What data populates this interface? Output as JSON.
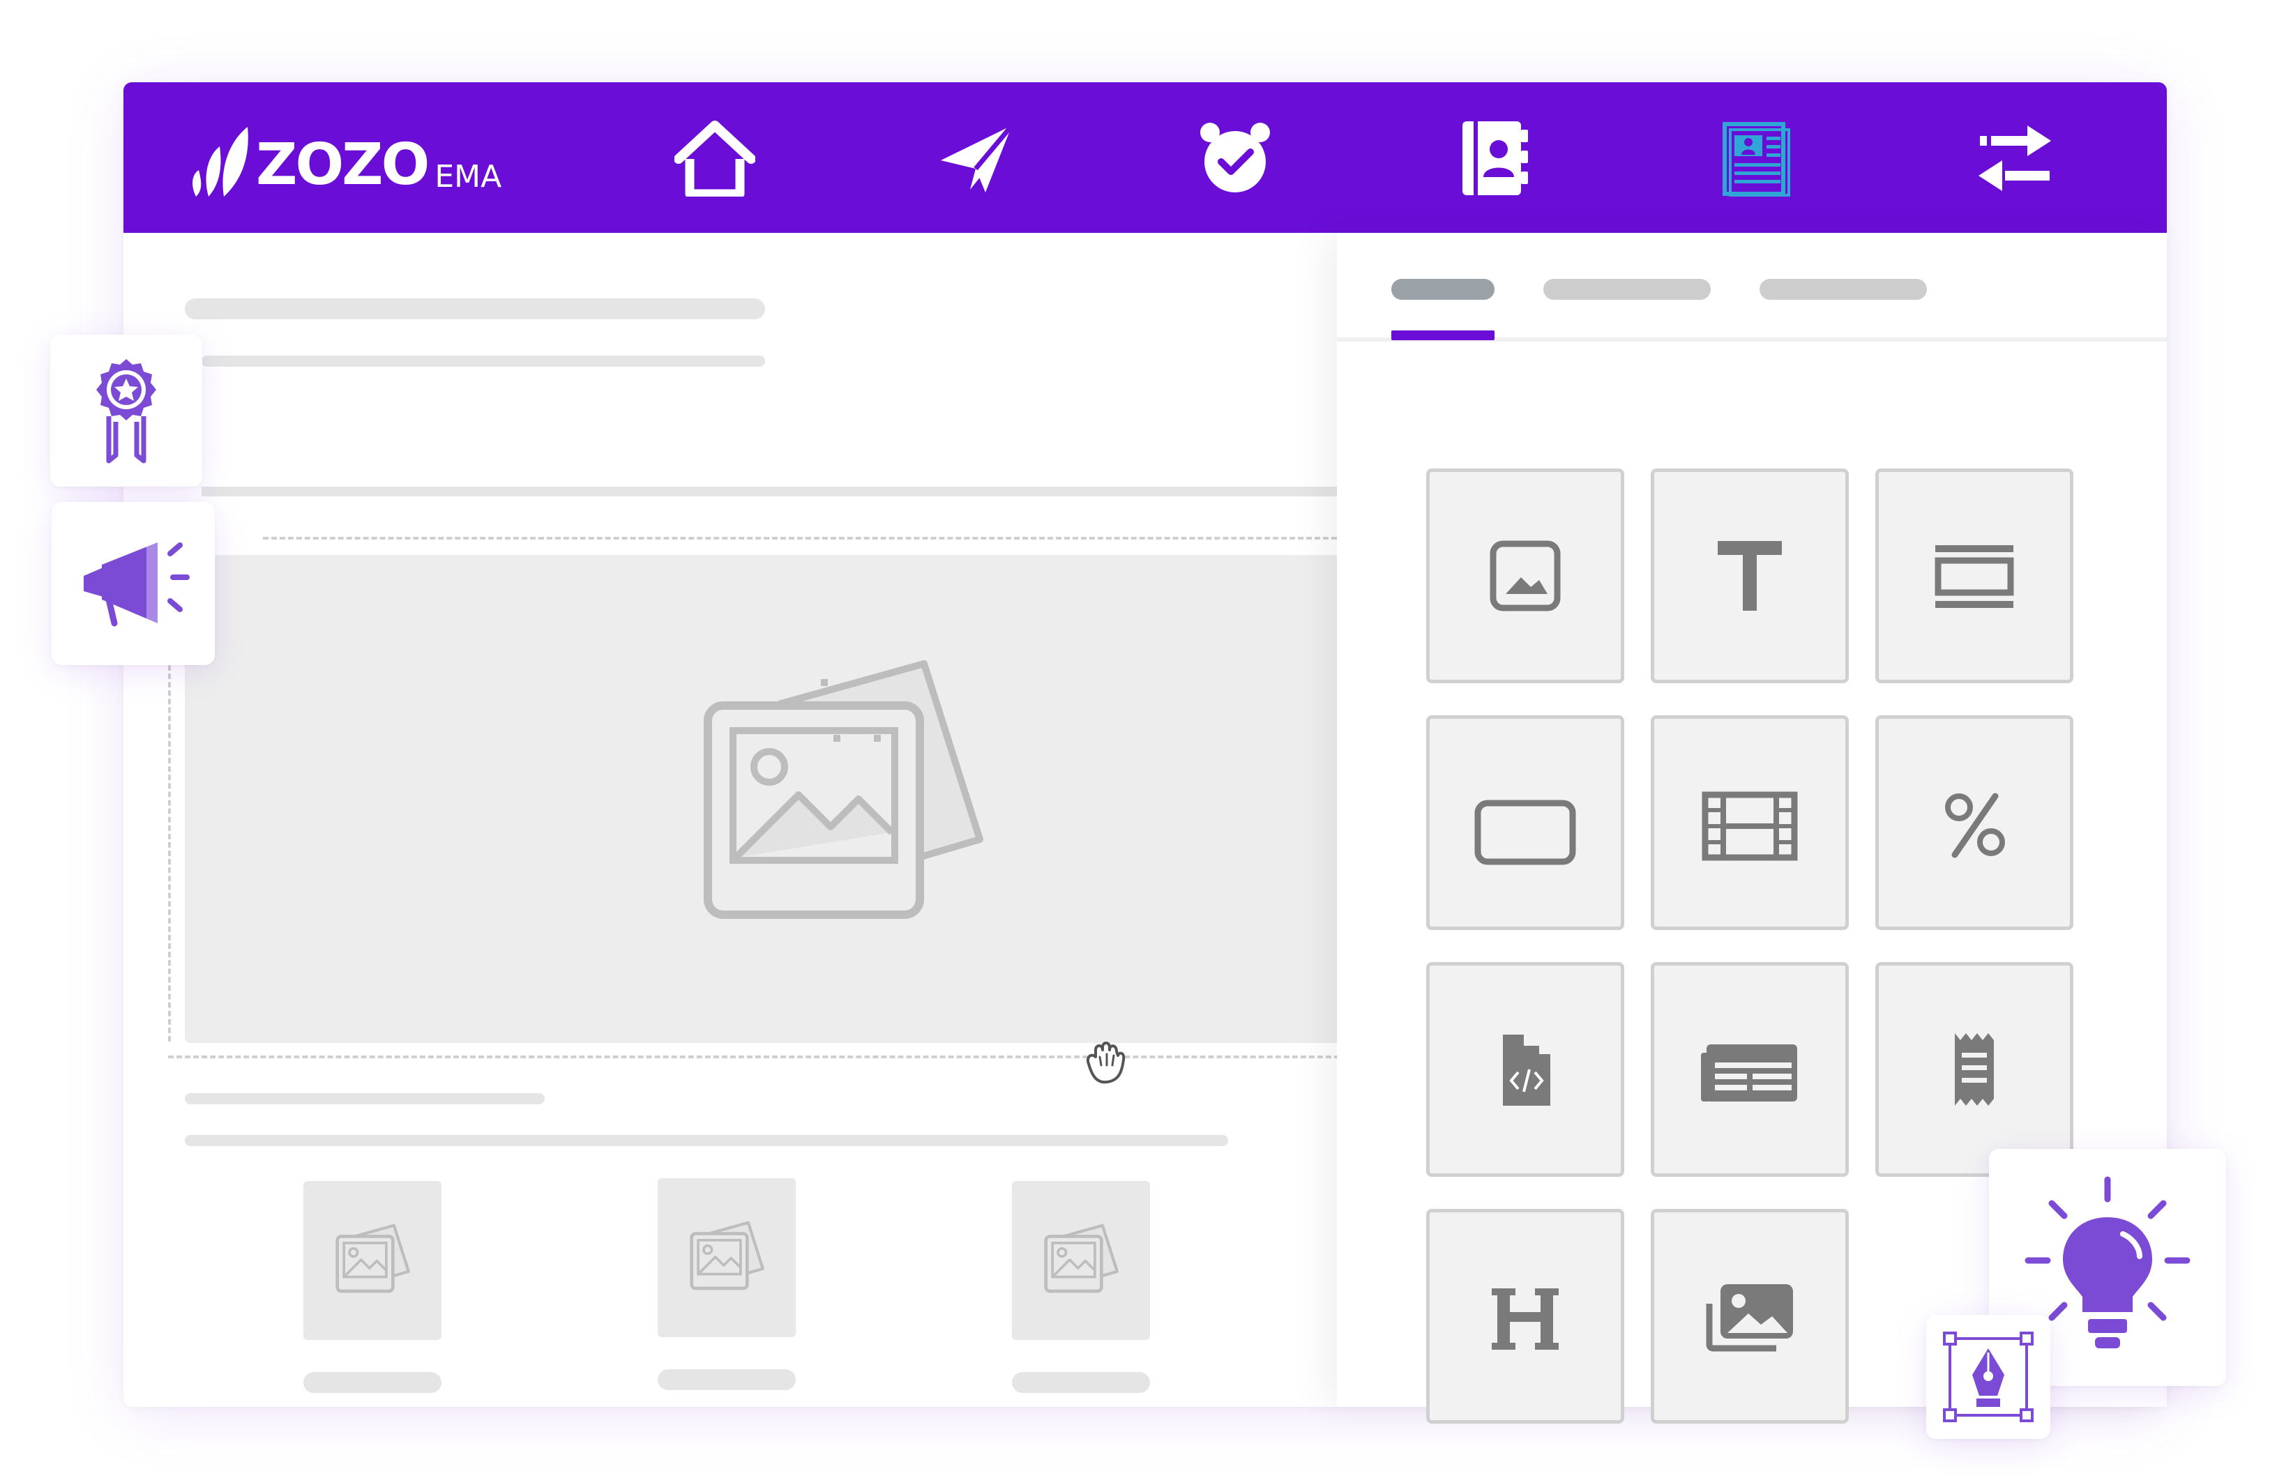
{
  "app": {
    "brand": "ZOZO",
    "brand_suffix": "EMA"
  },
  "nav": {
    "items": [
      {
        "icon": "home-icon"
      },
      {
        "icon": "paper-plane-icon"
      },
      {
        "icon": "alarm-clock-icon"
      },
      {
        "icon": "address-book-icon"
      },
      {
        "icon": "newsletter-icon",
        "active": true
      },
      {
        "icon": "transfer-arrows-icon"
      }
    ],
    "active_icon_color": "#2FA6D6"
  },
  "panel": {
    "tabs_count": 3,
    "active_tab": 0,
    "blocks": [
      {
        "icon": "image-block-icon"
      },
      {
        "icon": "text-block-icon"
      },
      {
        "icon": "divider-block-icon"
      },
      {
        "icon": "button-block-icon"
      },
      {
        "icon": "video-block-icon"
      },
      {
        "icon": "coupon-block-icon"
      },
      {
        "icon": "html-block-icon"
      },
      {
        "icon": "table-block-icon"
      },
      {
        "icon": "receipt-block-icon"
      },
      {
        "icon": "heading-block-icon"
      },
      {
        "icon": "image-gallery-block-icon"
      }
    ]
  },
  "floating": [
    {
      "icon": "award-ribbon-icon"
    },
    {
      "icon": "megaphone-icon"
    },
    {
      "icon": "lightbulb-icon"
    },
    {
      "icon": "pen-tool-icon"
    }
  ],
  "colors": {
    "brand": "#6A0DD6",
    "accent_purple": "#7B4BD6",
    "tile_icon": "#7a7a7a",
    "placeholder": "#bdbdbd"
  }
}
